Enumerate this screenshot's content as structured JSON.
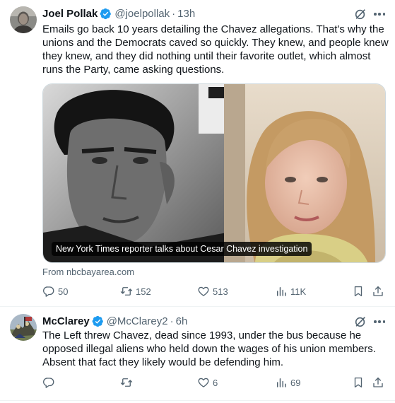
{
  "tweets": [
    {
      "author": "Joel Pollak",
      "handle": "@joelpollak",
      "dot": "·",
      "time": "13h",
      "text_lines": [
        "Emails go back 10 years detailing the Chavez allegations. That's why the",
        "unions and the Democrats caved so quickly. They knew, and people knew",
        "they knew, and they did nothing until their favorite outlet, which almost",
        "runs the Party, came asking questions."
      ],
      "media_caption": "New York Times reporter talks about Cesar Chavez investigation",
      "source": "From nbcbayarea.com",
      "replies": "50",
      "reposts": "152",
      "likes": "513",
      "views": "11K"
    },
    {
      "author": "McClarey",
      "handle": "@McClarey2",
      "dot": "·",
      "time": "6h",
      "text_lines": [
        "The Left threw Chavez, dead since 1993, under the bus because he",
        "opposed illegal aliens who held down the wages of his union members.",
        "Absent that fact they likely would be defending him."
      ],
      "replies": "",
      "reposts": "",
      "likes": "6",
      "views": "69"
    }
  ],
  "icons": {
    "verified": "verified-badge-icon",
    "grok": "grok-icon",
    "more": "more-icon",
    "reply": "reply-icon",
    "repost": "repost-icon",
    "like": "heart-icon",
    "views": "views-icon",
    "bookmark": "bookmark-icon",
    "share": "share-icon"
  },
  "colors": {
    "verified": "#1d9bf0",
    "text": "#0f1419",
    "secondary": "#536471"
  }
}
